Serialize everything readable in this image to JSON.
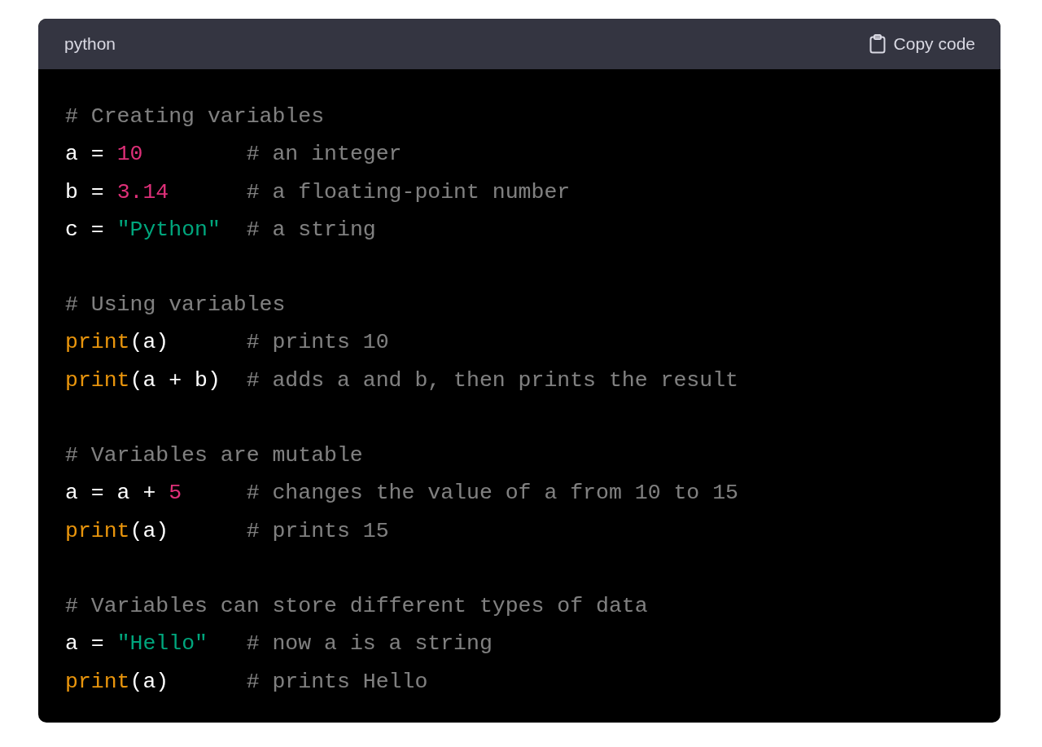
{
  "header": {
    "language": "python",
    "copy_label": "Copy code"
  },
  "blocks": [
    {
      "lines": [
        {
          "tokens": [
            {
              "kind": "comment",
              "text": "# Creating variables"
            }
          ]
        },
        {
          "tokens": [
            {
              "kind": "plain",
              "text": "a = "
            },
            {
              "kind": "number",
              "text": "10"
            },
            {
              "kind": "comment",
              "text": "        # an integer"
            }
          ]
        },
        {
          "tokens": [
            {
              "kind": "plain",
              "text": "b = "
            },
            {
              "kind": "number",
              "text": "3.14"
            },
            {
              "kind": "comment",
              "text": "      # a floating-point number"
            }
          ]
        },
        {
          "tokens": [
            {
              "kind": "plain",
              "text": "c = "
            },
            {
              "kind": "string",
              "text": "\"Python\""
            },
            {
              "kind": "comment",
              "text": "  # a string"
            }
          ]
        }
      ]
    },
    {
      "lines": [
        {
          "tokens": [
            {
              "kind": "comment",
              "text": "# Using variables"
            }
          ]
        },
        {
          "tokens": [
            {
              "kind": "builtin",
              "text": "print"
            },
            {
              "kind": "plain",
              "text": "(a)"
            },
            {
              "kind": "comment",
              "text": "      # prints 10"
            }
          ]
        },
        {
          "tokens": [
            {
              "kind": "builtin",
              "text": "print"
            },
            {
              "kind": "plain",
              "text": "(a + b)"
            },
            {
              "kind": "comment",
              "text": "  # adds a and b, then prints the result"
            }
          ]
        }
      ]
    },
    {
      "lines": [
        {
          "tokens": [
            {
              "kind": "comment",
              "text": "# Variables are mutable"
            }
          ]
        },
        {
          "tokens": [
            {
              "kind": "plain",
              "text": "a = a + "
            },
            {
              "kind": "number",
              "text": "5"
            },
            {
              "kind": "comment",
              "text": "     # changes the value of a from 10 to 15"
            }
          ]
        },
        {
          "tokens": [
            {
              "kind": "builtin",
              "text": "print"
            },
            {
              "kind": "plain",
              "text": "(a)"
            },
            {
              "kind": "comment",
              "text": "      # prints 15"
            }
          ]
        }
      ]
    },
    {
      "lines": [
        {
          "tokens": [
            {
              "kind": "comment",
              "text": "# Variables can store different types of data"
            }
          ]
        },
        {
          "tokens": [
            {
              "kind": "plain",
              "text": "a = "
            },
            {
              "kind": "string",
              "text": "\"Hello\""
            },
            {
              "kind": "comment",
              "text": "   # now a is a string"
            }
          ]
        },
        {
          "tokens": [
            {
              "kind": "builtin",
              "text": "print"
            },
            {
              "kind": "plain",
              "text": "(a)"
            },
            {
              "kind": "comment",
              "text": "      # prints Hello"
            }
          ]
        }
      ]
    }
  ]
}
